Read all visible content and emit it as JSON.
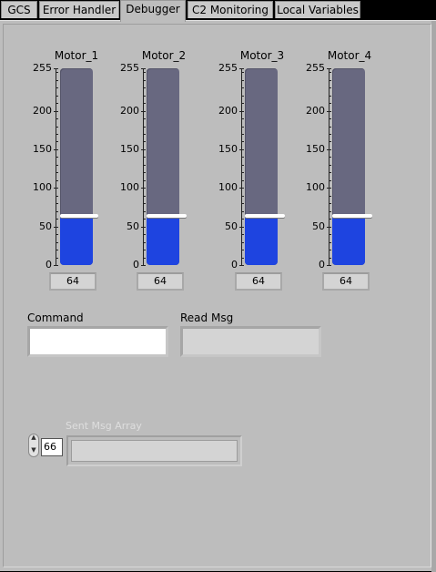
{
  "tabs": [
    {
      "label": "GCS",
      "active": false
    },
    {
      "label": "Error Handler",
      "active": false
    },
    {
      "label": "Debugger",
      "active": true
    },
    {
      "label": "C2 Monitoring",
      "active": false
    },
    {
      "label": "Local Variables",
      "active": false
    }
  ],
  "motors": [
    {
      "label": "Motor_1",
      "value": 64,
      "readout": "64"
    },
    {
      "label": "Motor_2",
      "value": 64,
      "readout": "64"
    },
    {
      "label": "Motor_3",
      "value": 64,
      "readout": "64"
    },
    {
      "label": "Motor_4",
      "value": 64,
      "readout": "64"
    }
  ],
  "scale": {
    "min": 0,
    "max": 255,
    "ticks": [
      "255",
      "200",
      "150",
      "100",
      "50",
      "0"
    ]
  },
  "command": {
    "label": "Command",
    "value": ""
  },
  "read_msg": {
    "label": "Read Msg",
    "value": ""
  },
  "sent_msg_array": {
    "label": "Sent Msg Array",
    "index": "66",
    "element": ""
  },
  "colors": {
    "fill": "#1e44e0",
    "track": "#686880",
    "panel": "#bdbdbd"
  }
}
